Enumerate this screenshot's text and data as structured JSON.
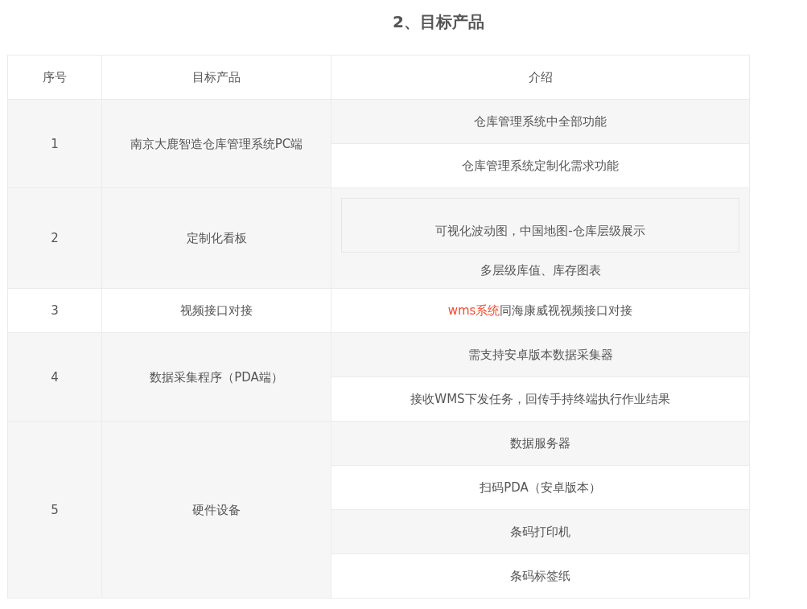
{
  "heading": "2、目标产品",
  "table": {
    "columns": [
      "序号",
      "目标产品",
      "介绍"
    ],
    "rows": [
      {
        "index": "1",
        "product": "南京大鹿智造仓库管理系统PC端",
        "intro": [
          {
            "text": "仓库管理系统中全部功能"
          },
          {
            "text": "仓库管理系统定制化需求功能"
          }
        ]
      },
      {
        "index": "2",
        "product": "定制化看板",
        "intro": [
          {
            "paragraphs": [
              {
                "kind": "boxed",
                "text": "可视化波动图，中国地图-仓库层级展示"
              },
              {
                "kind": "plain",
                "text": "多层级库值、库存图表"
              }
            ]
          }
        ]
      },
      {
        "index": "3",
        "product": "视频接口对接",
        "intro": [
          {
            "segments": [
              {
                "text": "wms系统",
                "highlighted": true
              },
              {
                "text": "同海康威视视频接口对接",
                "highlighted": false
              }
            ]
          }
        ]
      },
      {
        "index": "4",
        "product": "数据采集程序（PDA端）",
        "intro": [
          {
            "text": "需支持安卓版本数据采集器"
          },
          {
            "text": "接收WMS下发任务，回传手持终端执行作业结果"
          }
        ]
      },
      {
        "index": "5",
        "product": "硬件设备",
        "intro": [
          {
            "text": "数据服务器"
          },
          {
            "text": "扫码PDA（安卓版本）"
          },
          {
            "text": "条码打印机"
          },
          {
            "text": "条码标签纸"
          }
        ]
      }
    ]
  }
}
